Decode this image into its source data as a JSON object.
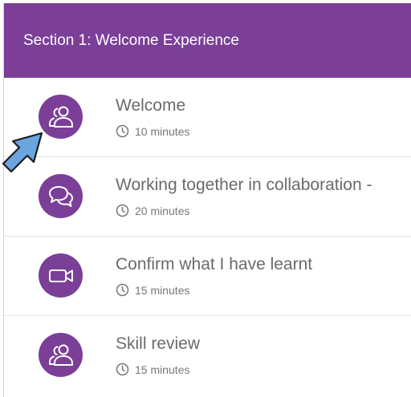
{
  "header": {
    "title": "Section 1: Welcome Experience"
  },
  "colors": {
    "accent": "#7b3f98",
    "pointer": "#6aa5de"
  },
  "items": [
    {
      "title": "Welcome",
      "duration": "10 minutes",
      "icon": "people-icon"
    },
    {
      "title": "Working together in collaboration -",
      "duration": "20 minutes",
      "icon": "chat-bubbles-icon"
    },
    {
      "title": "Confirm what I have learnt",
      "duration": "15 minutes",
      "icon": "video-camera-icon"
    },
    {
      "title": "Skill review",
      "duration": "15 minutes",
      "icon": "people-icon"
    }
  ]
}
